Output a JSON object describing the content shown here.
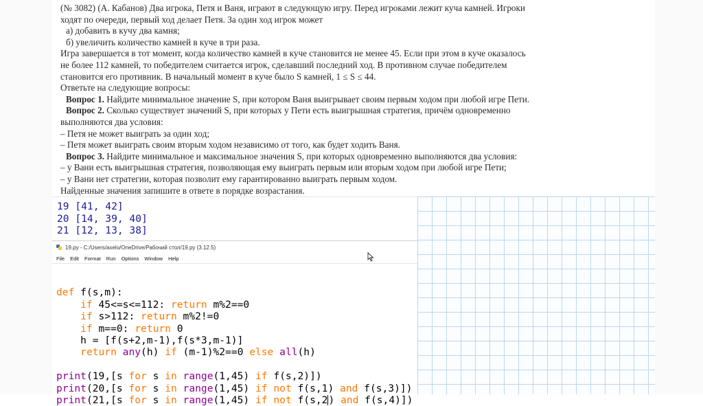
{
  "problem": {
    "lines": [
      "(№ 3082) (А. Кабанов) Два игрока, Петя и Ваня, играют в следующую игру. Перед игроками лежит куча камней. Игроки",
      "ходят по очереди, первый ход делает Петя. За один ход игрок может",
      "а) добавить в кучу два камня;",
      "б) увеличить количество камней в куче в три раза.",
      "Игра завершается в тот момент, когда количество камней в куче становится не менее 45. Если при этом в куче оказалось",
      "не более 112 камней, то победителем считается игрок, сделавший последний ход. В противном случае победителем",
      "становится его противник. В начальный момент в куче было S камней, 1 ≤ S ≤ 44.",
      "Ответьте на следующие вопросы:"
    ],
    "q1_label": "Вопрос 1.",
    "q1_text": " Найдите минимальное значение S, при котором Ваня выигрывает своим первым ходом при любой игре Пети.",
    "q2_label": "Вопрос 2.",
    "q2_text": " Сколько существует значений S, при которых у Пети есть выигрышная стратегия, причём одновременно",
    "q2_lines": [
      "выполняются два условия:",
      "– Петя не может выиграть за один ход;",
      "– Петя может выиграть своим вторым ходом независимо от того, как будет ходить Ваня."
    ],
    "q3_label": "Вопрос 3.",
    "q3_text": " Найдите минимальное и максимальное значения S, при которых одновременно выполняются два условия:",
    "q3_lines": [
      "– у Вани есть выигрышная стратегия, позволяющая ему выиграть первым или вторым ходом при любой игре Пети;",
      "– у Вани нет стратегии, которая позволит ему гарантированно выиграть первым ходом.",
      "Найденные значения запишите в ответе в порядке возрастания."
    ]
  },
  "output": [
    "19 [41, 42]",
    "20 [14, 39, 40]",
    "21 [12, 13, 38]"
  ],
  "idle": {
    "title": "19.py - C:/Users/axelo/OneDrive/Рабочий стол/19.py (3.12.5)",
    "menu": [
      "File",
      "Edit",
      "Format",
      "Run",
      "Options",
      "Window",
      "Help"
    ]
  },
  "code": {
    "l1_kw": "def",
    "l1_rest": " f(s,m):",
    "l2_ind": "    ",
    "l2_kw": "if",
    "l2_mid": " 45<=s<=112: ",
    "l2_kw2": "return",
    "l2_rest": " m%2==0",
    "l3_ind": "    ",
    "l3_kw": "if",
    "l3_mid": " s>112: ",
    "l3_kw2": "return",
    "l3_rest": " m%2!=0",
    "l4_ind": "    ",
    "l4_kw": "if",
    "l4_mid": " m==0: ",
    "l4_kw2": "return",
    "l4_rest": " 0",
    "l5": "    h = [f(s+2,m-1),f(s*3,m-1)]",
    "l6_ind": "    ",
    "l6_kw": "return",
    "l6_sp": " ",
    "l6_bi": "any",
    "l6_a": "(h) ",
    "l6_kw2": "if",
    "l6_b": " (m-1)%2==0 ",
    "l6_kw3": "else",
    "l6_sp2": " ",
    "l6_bi2": "all",
    "l6_c": "(h)",
    "p1_bi": "print",
    "p1_a": "(19,[s ",
    "p1_for": "for",
    "p1_b": " s ",
    "p1_in": "in",
    "p1_sp": " ",
    "p1_range": "range",
    "p1_c": "(1,45) ",
    "p1_if": "if",
    "p1_d": " f(s,2)])",
    "p2_bi": "print",
    "p2_a": "(20,[s ",
    "p2_for": "for",
    "p2_b": " s ",
    "p2_in": "in",
    "p2_sp": " ",
    "p2_range": "range",
    "p2_c": "(1,45) ",
    "p2_if": "if",
    "p2_sp2": " ",
    "p2_not": "not",
    "p2_d": " f(s,1) ",
    "p2_and": "and",
    "p2_e": " f(s,3)])",
    "p3_bi": "print",
    "p3_a": "(21,[s ",
    "p3_for": "for",
    "p3_b": " s ",
    "p3_in": "in",
    "p3_sp": " ",
    "p3_range": "range",
    "p3_c": "(1,45) ",
    "p3_if": "if",
    "p3_sp2": " ",
    "p3_not": "not",
    "p3_d": " f(s,2",
    "p3_e": ") ",
    "p3_and": "and",
    "p3_f": " f(s,4)])"
  }
}
